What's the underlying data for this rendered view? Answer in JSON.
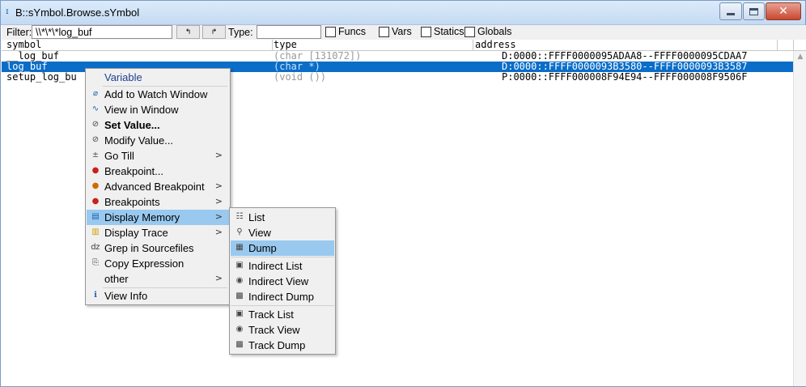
{
  "window": {
    "title": "B::sYmbol.Browse.sYmbol",
    "close_glyph": "✕"
  },
  "toolbar": {
    "filter_label": "Filter:",
    "filter_value": "\\\\*\\*\\*log_buf",
    "type_label": "Type:",
    "type_value": "",
    "arrow_up_glyph": "↰",
    "arrow_right_glyph": "↱",
    "checkboxes": [
      {
        "label": "Funcs",
        "checked": false
      },
      {
        "label": "Vars",
        "checked": false
      },
      {
        "label": "Statics",
        "checked": false
      },
      {
        "label": "Globals",
        "checked": false
      }
    ]
  },
  "table": {
    "columns": [
      "symbol",
      "type",
      "address"
    ],
    "rows": [
      {
        "symbol": "__log_buf",
        "type": "(char [131072])",
        "address": "D:0000::FFFF0000095ADAA8--FFFF0000095CDAA7",
        "selected": false
      },
      {
        "symbol": "log_buf",
        "type": "(char *)",
        "address": "D:0000::FFFF0000093B3580--FFFF0000093B3587",
        "selected": true
      },
      {
        "symbol": "setup_log_bu",
        "type": "(void ())",
        "address": "P:0000::FFFF000008F94E94--FFFF000008F9506F",
        "selected": false
      }
    ]
  },
  "context_menu": {
    "items": [
      {
        "label": "Variable",
        "icon": "",
        "submenu": false
      },
      {
        "label": "Add to Watch Window",
        "icon": "watch-icon",
        "glyph": "⌀",
        "submenu": false
      },
      {
        "label": "View in Window",
        "icon": "view-icon",
        "glyph": "∿",
        "submenu": false
      },
      {
        "label": "Set Value...",
        "icon": "set-value-icon",
        "glyph": "⊘",
        "submenu": false
      },
      {
        "label": "Modify Value...",
        "icon": "modify-icon",
        "glyph": "⊘",
        "submenu": false
      },
      {
        "label": "Go Till",
        "icon": "go-till-icon",
        "glyph": "±",
        "submenu": true
      },
      {
        "label": "Breakpoint...",
        "icon": "breakpoint-icon",
        "glyph": "●",
        "submenu": false
      },
      {
        "label": "Advanced Breakpoint",
        "icon": "advanced-breakpoint-icon",
        "glyph": "●",
        "submenu": true
      },
      {
        "label": "Breakpoints",
        "icon": "breakpoints-icon",
        "glyph": "●",
        "submenu": true
      },
      {
        "label": "Display Memory",
        "icon": "memory-icon",
        "glyph": "▤",
        "submenu": true
      },
      {
        "label": "Display Trace",
        "icon": "trace-icon",
        "glyph": "▥",
        "submenu": true
      },
      {
        "label": "Grep in Sourcefiles",
        "icon": "grep-icon",
        "glyph": "ǳ",
        "submenu": false
      },
      {
        "label": "Copy Expression",
        "icon": "copy-icon",
        "glyph": "⎘",
        "submenu": false
      },
      {
        "label": "other",
        "icon": "",
        "submenu": true
      },
      {
        "label": "View Info",
        "icon": "info-icon",
        "glyph": "ℹ",
        "submenu": false
      }
    ],
    "arrow_glyph": ">"
  },
  "submenu": {
    "items": [
      {
        "label": "List",
        "icon": "list-icon",
        "glyph": "☷"
      },
      {
        "label": "View",
        "icon": "magnifier-icon",
        "glyph": "⚲"
      },
      {
        "label": "Dump",
        "icon": "dump-icon",
        "glyph": "▦"
      },
      {
        "label": "Indirect List",
        "icon": "indirect-list-icon",
        "glyph": "▣"
      },
      {
        "label": "Indirect View",
        "icon": "indirect-view-icon",
        "glyph": "◉"
      },
      {
        "label": "Indirect Dump",
        "icon": "indirect-dump-icon",
        "glyph": "▩"
      },
      {
        "label": "Track List",
        "icon": "track-list-icon",
        "glyph": "▣"
      },
      {
        "label": "Track View",
        "icon": "track-view-icon",
        "glyph": "◉"
      },
      {
        "label": "Track Dump",
        "icon": "track-dump-icon",
        "glyph": "▩"
      }
    ]
  },
  "colors": {
    "selection": "#0a6dc8",
    "menu_highlight": "#99c9ef"
  }
}
